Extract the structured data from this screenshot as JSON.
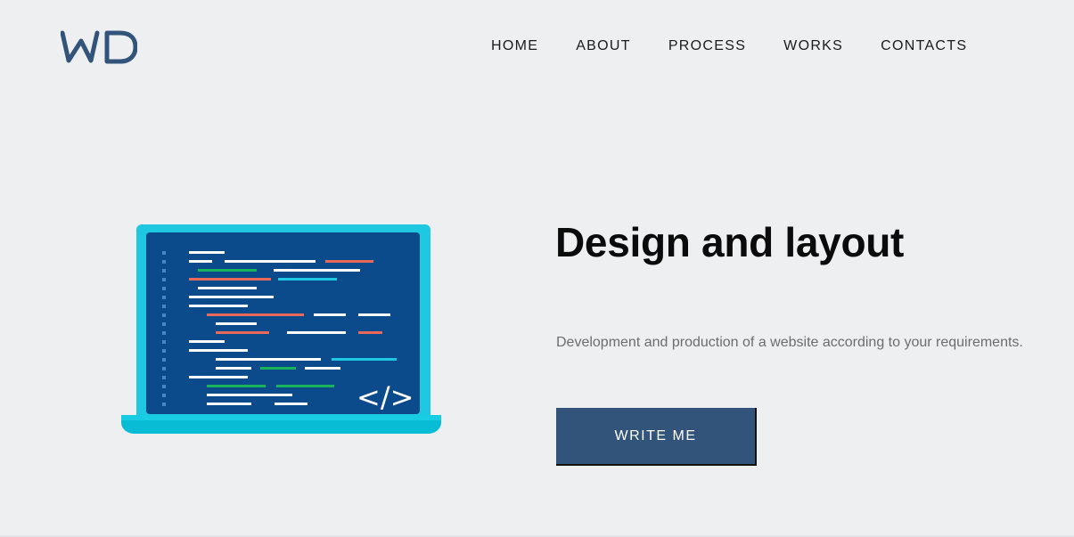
{
  "header": {
    "logo_text": "WD",
    "nav": [
      {
        "label": "HOME"
      },
      {
        "label": "ABOUT"
      },
      {
        "label": "PROCESS"
      },
      {
        "label": "WORKS"
      },
      {
        "label": "CONTACTS"
      }
    ]
  },
  "hero": {
    "illustration_icon": "laptop-code-icon",
    "code_symbol": "</>",
    "title": "Design and layout",
    "description": "Development and production of a website according to your requirements.",
    "button_label": "WRITE ME"
  },
  "colors": {
    "background": "#eeeff1",
    "accent": "#33547a",
    "laptop_frame": "#1ec8e0",
    "screen": "#0b4a8b"
  }
}
